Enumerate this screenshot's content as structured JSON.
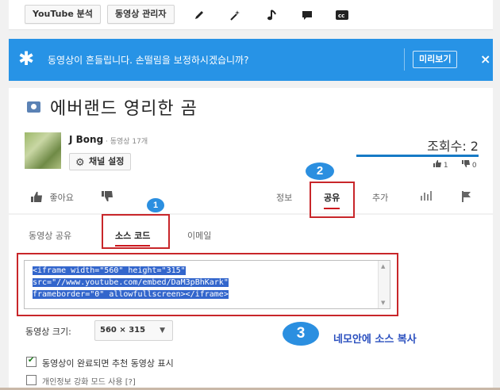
{
  "toolbar": {
    "analytics_label": "YouTube 분석",
    "video_manager_label": "동영상 관리자"
  },
  "banner": {
    "message": "동영상이 흔들립니다. 손떨림을 보정하시겠습니까?",
    "preview_label": "미리보기",
    "close_label": "×"
  },
  "video": {
    "title": "에버랜드 영리한 곰",
    "channel_name": "J Bong",
    "video_count": "· 동영상 17개",
    "channel_settings_label": "채널 설정",
    "views": "조회수: 2",
    "like_count": "1",
    "dislike_count": "0"
  },
  "actions": {
    "like_label": "좋아요",
    "info_tab": "정보",
    "share_tab": "공유",
    "add_tab": "추가"
  },
  "share": {
    "tab_share": "동영상 공유",
    "tab_embed": "소스 코드",
    "tab_email": "이메일",
    "embed_code_lines": [
      "<iframe width=\"560\" height=\"315\"",
      "src=\"//www.youtube.com/embed/DaM3pBhKark\"",
      "frameborder=\"0\" allowfullscreen></iframe>"
    ],
    "size_label": "동영상 크기:",
    "size_value": "560 × 315",
    "option_suggested": "동영상이 완료되면 추천 동영상 표시",
    "option_privacy": "개인정보 강화 모드 사용 [?]"
  },
  "annotations": {
    "step1": "1",
    "step2": "2",
    "step3": "3",
    "step3_note": "네모안에 소스 복사"
  },
  "colors": {
    "banner": "#2793e6",
    "accent_red": "#cc181e",
    "annotation_box": "#c8262a",
    "annotation_badge": "#2b8fe0"
  }
}
